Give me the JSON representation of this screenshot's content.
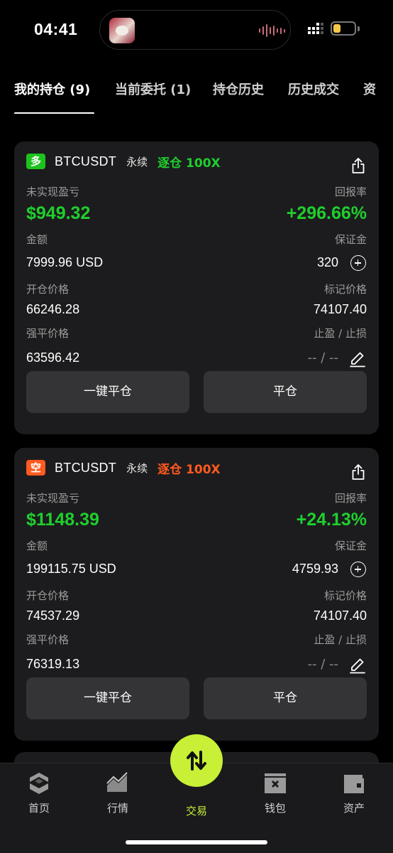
{
  "status_bar": {
    "time": "04:41"
  },
  "tabs": [
    {
      "label": "我的持仓 (9)",
      "active": true
    },
    {
      "label": "当前委托 (1)",
      "active": false
    },
    {
      "label": "持仓历史",
      "active": false
    },
    {
      "label": "历史成交",
      "active": false
    },
    {
      "label": "资",
      "active": false
    }
  ],
  "positions": [
    {
      "side": "多",
      "symbol": "BTCUSDT",
      "contract_type": "永续",
      "margin_mode": "逐仓 100X",
      "mode_color": "#1fcf2d",
      "unrealized_pnl_label": "未实现盈亏",
      "unrealized_pnl": "$949.32",
      "roi_label": "回报率",
      "roi": "+296.66%",
      "amount_label": "金额",
      "amount": "7999.96 USD",
      "margin_label": "保证金",
      "margin": "320",
      "entry_price_label": "开仓价格",
      "entry_price": "66246.28",
      "mark_price_label": "标记价格",
      "mark_price": "74107.40",
      "liq_price_label": "强平价格",
      "liq_price": "63596.42",
      "tpsl_label": "止盈 / 止损",
      "tpsl": "-- / --",
      "close_all_label": "一键平仓",
      "close_label": "平仓"
    },
    {
      "side": "空",
      "symbol": "BTCUSDT",
      "contract_type": "永续",
      "margin_mode": "逐仓 100X",
      "mode_color": "#ff5a1f",
      "unrealized_pnl_label": "未实现盈亏",
      "unrealized_pnl": "$1148.39",
      "roi_label": "回报率",
      "roi": "+24.13%",
      "amount_label": "金额",
      "amount": "199115.75 USD",
      "margin_label": "保证金",
      "margin": "4759.93",
      "entry_price_label": "开仓价格",
      "entry_price": "74537.29",
      "mark_price_label": "标记价格",
      "mark_price": "74107.40",
      "liq_price_label": "强平价格",
      "liq_price": "76319.13",
      "tpsl_label": "止盈 / 止损",
      "tpsl": "-- / --",
      "close_all_label": "一键平仓",
      "close_label": "平仓"
    }
  ],
  "bottom_nav": [
    {
      "label": "首页",
      "icon": "home-logo-icon",
      "active": false
    },
    {
      "label": "行情",
      "icon": "market-chart-icon",
      "active": false
    },
    {
      "label": "交易",
      "icon": "trade-swap-icon",
      "active": true
    },
    {
      "label": "钱包",
      "icon": "wallet-icon",
      "active": false
    },
    {
      "label": "资产",
      "icon": "assets-icon",
      "active": false
    }
  ],
  "colors": {
    "accent": "#c7f036",
    "profit": "#1fcf2d",
    "long": "#1dc21d",
    "short": "#ff5a1f"
  }
}
